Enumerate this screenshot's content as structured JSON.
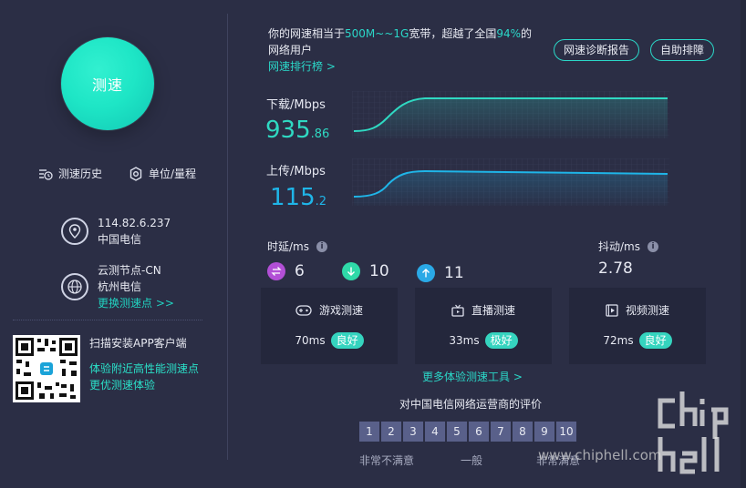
{
  "left": {
    "start_button_label": "测速",
    "history_label": "测速历史",
    "unit_label": "单位/量程",
    "ip": "114.82.6.237",
    "isp": "中国电信",
    "node_name": "云测节点-CN",
    "node_city": "杭州电信",
    "change_node_link": "更换测速点 >>",
    "qr_title": "扫描安装APP客户端",
    "qr_line1": "体验附近高性能测速点",
    "qr_line2": "更优测速体验"
  },
  "summary": {
    "prefix": "你的网速相当于",
    "range": "500M~~1G",
    "middle": "宽带，超越了全国",
    "percent": "94%",
    "suffix": "的网络用户",
    "rank_link": "网速排行榜 >",
    "diagnose_button": "网速诊断报告",
    "self_check_button": "自助排障"
  },
  "download": {
    "label": "下载/Mbps",
    "value_int": "935",
    "value_dec": ".86"
  },
  "upload": {
    "label": "上传/Mbps",
    "value_int": "115",
    "value_dec": ".2"
  },
  "latency": {
    "label": "时延/ms",
    "values": [
      "6",
      "10",
      "11"
    ]
  },
  "jitter": {
    "label": "抖动/ms",
    "value": "2.78"
  },
  "cards": [
    {
      "title": "游戏测速",
      "ms": "70ms",
      "badge": "良好",
      "icon": "gamepad-icon"
    },
    {
      "title": "直播测速",
      "ms": "33ms",
      "badge": "极好",
      "icon": "tv-icon"
    },
    {
      "title": "视频测速",
      "ms": "72ms",
      "badge": "良好",
      "icon": "film-icon"
    }
  ],
  "more_tools_link": "更多体验测速工具 >",
  "rating": {
    "title": "对中国电信网络运营商的评价",
    "numbers": [
      "1",
      "2",
      "3",
      "4",
      "5",
      "6",
      "7",
      "8",
      "9",
      "10"
    ],
    "low_label": "非常不满意",
    "mid_label": "一般",
    "high_label": "非常满意"
  },
  "watermark": "www.chiphell.com",
  "colors": {
    "background": "#2b2e45",
    "accent": "#2bd7c8",
    "card": "#24273c",
    "rating_box": "#59608a"
  }
}
